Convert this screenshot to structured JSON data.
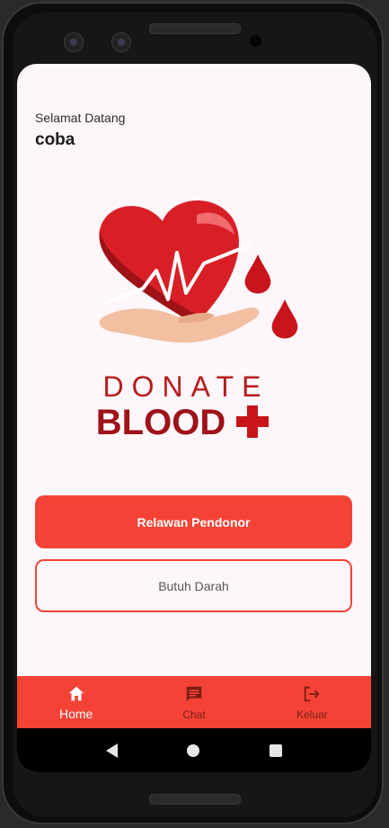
{
  "header": {
    "greeting": "Selamat Datang",
    "username": "coba"
  },
  "logo": {
    "line1": "DONATE",
    "line2": "BLOOD",
    "colors": {
      "heart": "#d81f26",
      "heart_dark": "#9e1218",
      "hand": "#f2bfa0",
      "text": "#b71c1c"
    }
  },
  "actions": {
    "primary_label": "Relawan Pendonor",
    "secondary_label": "Butuh Darah"
  },
  "bottom_nav": {
    "items": [
      {
        "label": "Home",
        "icon": "home-icon",
        "active": true
      },
      {
        "label": "Chat",
        "icon": "chat-icon",
        "active": false
      },
      {
        "label": "Keluar",
        "icon": "logout-icon",
        "active": false
      }
    ]
  },
  "system_nav": {
    "icons": [
      "back-icon",
      "home-circle-icon",
      "recents-icon"
    ]
  },
  "theme": {
    "accent": "#f44336",
    "background": "#fdf6fb"
  }
}
